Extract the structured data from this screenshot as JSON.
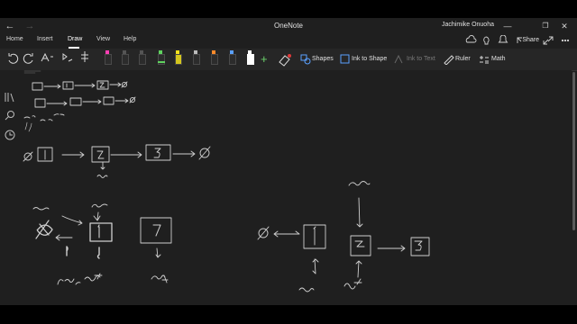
{
  "window": {
    "title": "OneNote",
    "user": "Jachimike Onuoha"
  },
  "menu": {
    "tabs": [
      {
        "label": "Home"
      },
      {
        "label": "Insert"
      },
      {
        "label": "Draw"
      },
      {
        "label": "View"
      },
      {
        "label": "Help"
      }
    ],
    "active_tab": "Draw",
    "share_label": "Share"
  },
  "ribbon": {
    "shapes_label": "Shapes",
    "ink_to_shape_label": "Ink to Shape",
    "ink_to_text_label": "Ink to Text",
    "ruler_label": "Ruler",
    "math_label": "Math",
    "pen_colors": [
      "#ff3fb4",
      "#444444",
      "#444444",
      "#444444",
      "#5fd35f",
      "#f4e21d",
      "#444444",
      "#ff8a2a",
      "#5aa0ff",
      "#ffffff"
    ]
  },
  "colors": {
    "background": "#1f1f1f",
    "ink": "#cfcfcf",
    "accent": "#ffffff"
  }
}
